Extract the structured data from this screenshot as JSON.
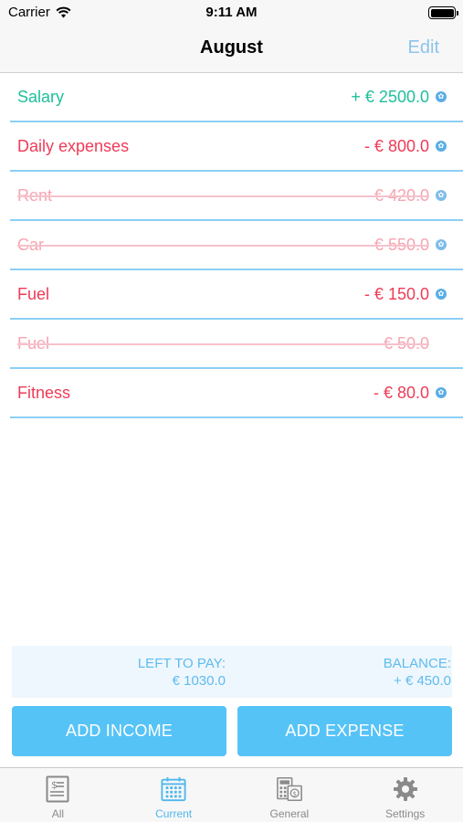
{
  "status": {
    "carrier": "Carrier",
    "time": "9:11 AM"
  },
  "nav": {
    "title": "August",
    "edit": "Edit"
  },
  "items": [
    {
      "name": "Salary",
      "amount": "+ € 2500.0",
      "kind": "income",
      "paid": false,
      "info": true
    },
    {
      "name": "Daily expenses",
      "amount": "- € 800.0",
      "kind": "expense",
      "paid": false,
      "info": true
    },
    {
      "name": "Rent",
      "amount": "- € 420.0",
      "kind": "expense",
      "paid": true,
      "info": true
    },
    {
      "name": "Car",
      "amount": "- € 550.0",
      "kind": "expense",
      "paid": true,
      "info": true
    },
    {
      "name": "Fuel",
      "amount": "- € 150.0",
      "kind": "expense",
      "paid": false,
      "info": true
    },
    {
      "name": "Fuel",
      "amount": "- € 50.0",
      "kind": "expense",
      "paid": true,
      "info": false
    },
    {
      "name": "Fitness",
      "amount": "- € 80.0",
      "kind": "expense",
      "paid": false,
      "info": true
    }
  ],
  "summary": {
    "left_label": "LEFT TO PAY:",
    "left_value": "€ 1030.0",
    "balance_label": "BALANCE:",
    "balance_value": "+ € 450.0"
  },
  "buttons": {
    "add_income": "ADD INCOME",
    "add_expense": "ADD EXPENSE"
  },
  "tabs": [
    {
      "label": "All",
      "icon": "document-dollar-icon",
      "active": false
    },
    {
      "label": "Current",
      "icon": "calendar-icon",
      "active": true
    },
    {
      "label": "General",
      "icon": "calculator-money-icon",
      "active": false
    },
    {
      "label": "Settings",
      "icon": "gear-icon",
      "active": false
    }
  ],
  "colors": {
    "income": "#1fbf9b",
    "expense": "#ef3b57",
    "paid": "#f6a4b1",
    "accent": "#56c3f6",
    "separator": "#8ccff5"
  }
}
